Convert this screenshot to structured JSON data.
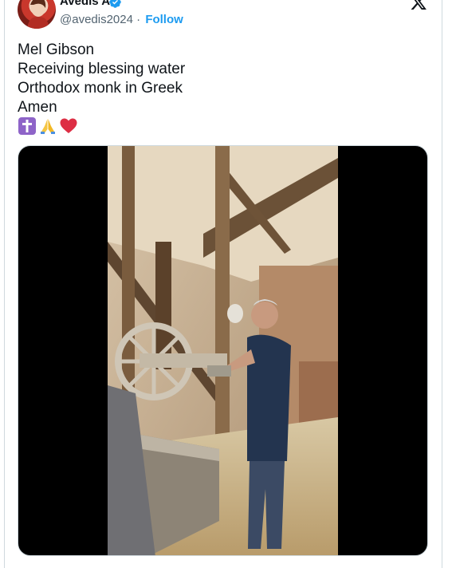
{
  "author": {
    "name": "Avedis A",
    "handle": "@avedis2024",
    "separator": "·",
    "follow_label": "Follow",
    "verified": true
  },
  "icons": {
    "avatar": "profile-photo",
    "verified": "verified-badge-icon",
    "platform": "x-logo-icon",
    "emojis": [
      "latin-cross-icon",
      "folded-hands-icon",
      "red-heart-icon"
    ]
  },
  "tweet": {
    "text": "Mel Gibson\nReceiving blessing water\nOrthodox monk in Greek\nAmen"
  },
  "media": {
    "type": "video"
  },
  "colors": {
    "accent": "#1d9bf0",
    "secondary_text": "#536471",
    "media_background": "#000000",
    "heart": "#dd2e44",
    "cross_bg": "#8e64c8"
  }
}
